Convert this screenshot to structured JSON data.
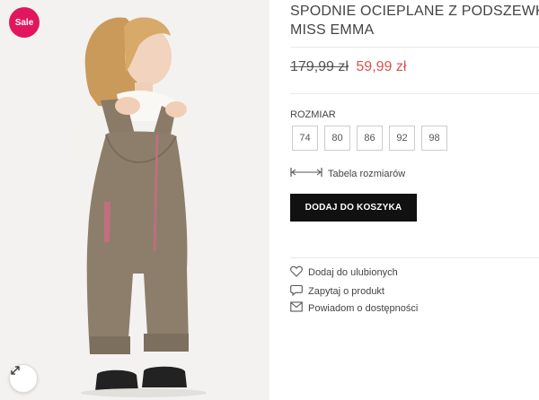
{
  "badge": {
    "label": "Sale"
  },
  "product": {
    "title_lines": [
      "SPODNIE OCIEPLANE Z PODSZEWKĄ",
      "MISS EMMA"
    ],
    "old_price": "179,99 zł",
    "new_price": "59,99 zł"
  },
  "sizes": {
    "label": "ROZMIAR",
    "options": [
      "74",
      "80",
      "86",
      "92",
      "98"
    ]
  },
  "size_table": {
    "label": "Tabela rozmiarów"
  },
  "cart": {
    "button_label": "DODAJ DO KOSZYKA"
  },
  "actions": {
    "wishlist": "Dodaj do ulubionych",
    "ask": "Zapytaj o produkt",
    "notify": "Powiadom o dostępności"
  },
  "colors": {
    "sale_badge": "#e2165f",
    "new_price": "#d9534f",
    "button": "#111111"
  },
  "icons": {
    "zoom": "expand-arrows-icon",
    "size_table": "ruler-icon",
    "wishlist": "heart-icon",
    "ask": "speech-bubble-icon",
    "notify": "envelope-icon"
  }
}
